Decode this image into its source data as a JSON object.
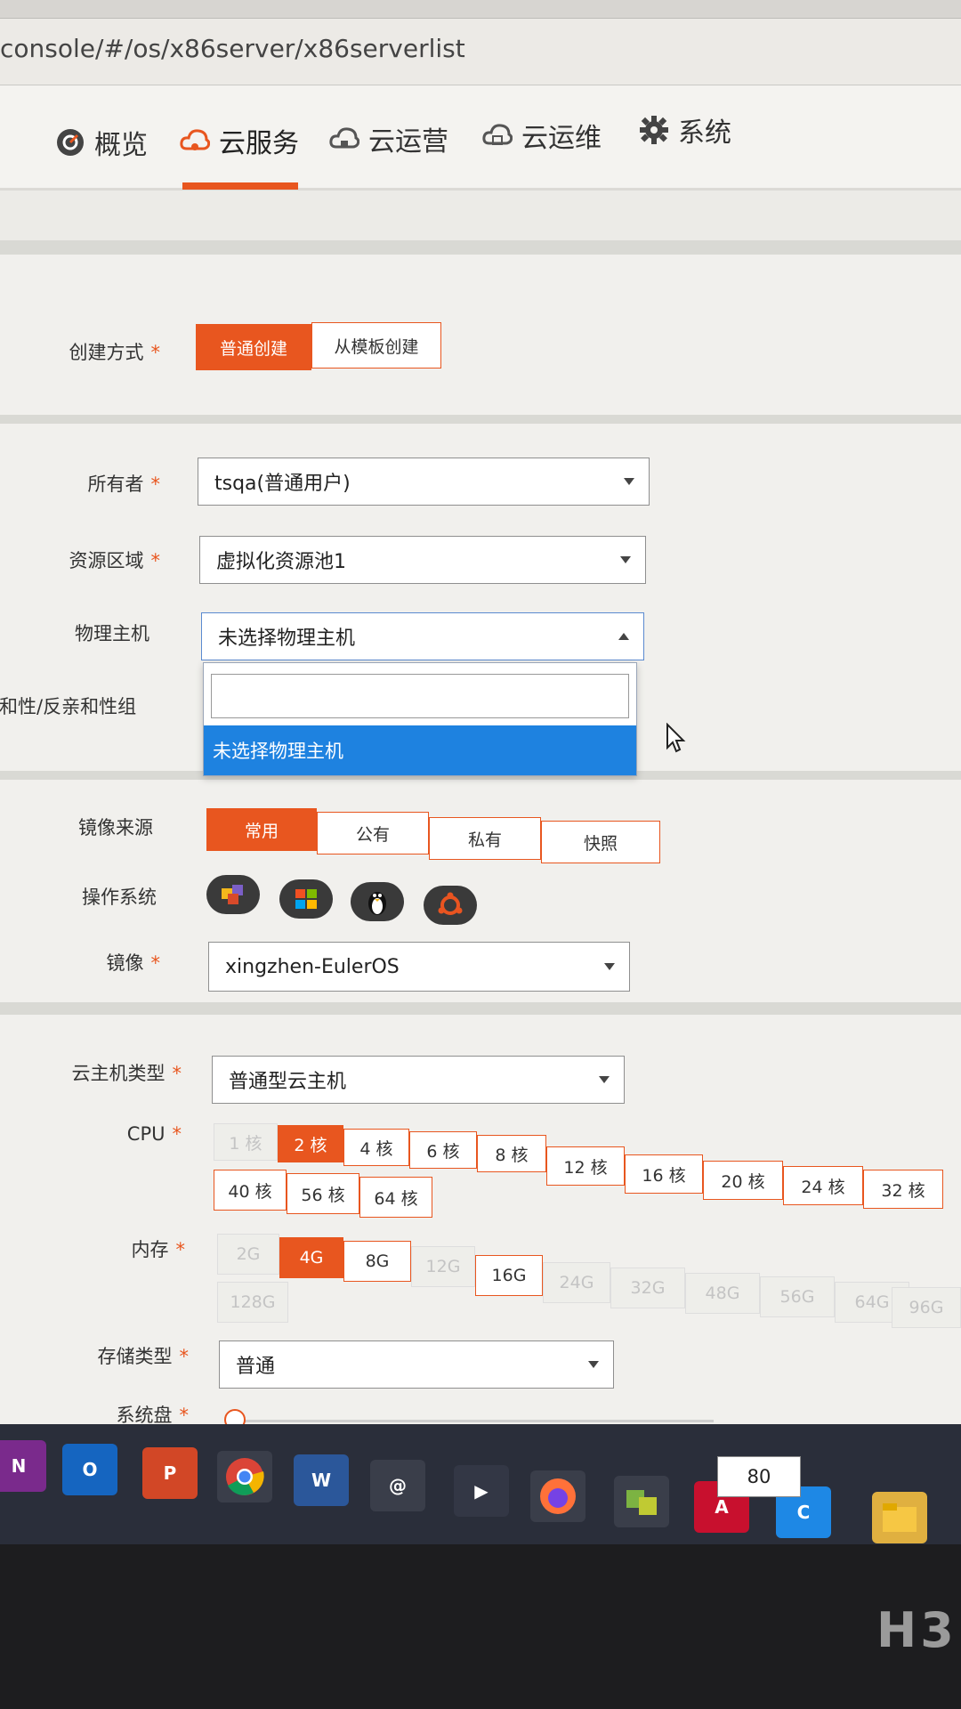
{
  "browser": {
    "url": "console/#/os/x86server/x86serverlist"
  },
  "nav": {
    "items": [
      {
        "label": "概览",
        "icon": "dashboard-icon"
      },
      {
        "label": "云服务",
        "icon": "cloud-service-icon"
      },
      {
        "label": "云运营",
        "icon": "cloud-operation-icon"
      },
      {
        "label": "云运维",
        "icon": "cloud-maintenance-icon"
      },
      {
        "label": "系统",
        "icon": "gear-icon"
      }
    ],
    "active": "云服务"
  },
  "form": {
    "create_mode": {
      "label": "创建方式",
      "options": [
        "普通创建",
        "从模板创建"
      ],
      "selected": "普通创建"
    },
    "owner": {
      "label": "所有者",
      "value": "tsqa(普通用户)"
    },
    "region": {
      "label": "资源区域",
      "value": "虚拟化资源池1"
    },
    "host": {
      "label": "物理主机",
      "value": "未选择物理主机",
      "dropdown_option": "未选择物理主机",
      "search_value": ""
    },
    "affinity": {
      "label": "亲和性/反亲和性组"
    },
    "image_source": {
      "label": "镜像来源",
      "options": [
        "常用",
        "公有",
        "私有",
        "快照"
      ],
      "selected": "常用"
    },
    "os": {
      "label": "操作系统",
      "icons": [
        "euleros-icon",
        "windows-icon",
        "linux-tux-icon",
        "ubuntu-icon"
      ]
    },
    "image": {
      "label": "镜像",
      "value": "xingzhen-EulerOS"
    },
    "vm_type": {
      "label": "云主机类型",
      "value": "普通型云主机"
    },
    "cpu": {
      "label": "CPU",
      "options": [
        "1 核",
        "2 核",
        "4 核",
        "6 核",
        "8 核",
        "12 核",
        "16 核",
        "20 核",
        "24 核",
        "32 核",
        "40 核",
        "56 核",
        "64 核"
      ],
      "selected": "2 核",
      "disabled": [
        "1 核"
      ]
    },
    "memory": {
      "label": "内存",
      "options": [
        "2G",
        "4G",
        "8G",
        "12G",
        "16G",
        "24G",
        "32G",
        "48G",
        "56G",
        "64G",
        "96G",
        "128G"
      ],
      "selected": "4G",
      "disabled": [
        "2G",
        "12G",
        "24G",
        "32G",
        "48G",
        "56G",
        "64G",
        "96G",
        "128G"
      ]
    },
    "storage_type": {
      "label": "存储类型",
      "value": "普通"
    },
    "system_disk": {
      "label": "系统盘",
      "value": "80"
    }
  },
  "taskbar": {
    "apps": [
      {
        "name": "onenote-icon",
        "glyph": "N",
        "color": "#7a2a8c"
      },
      {
        "name": "outlook-icon",
        "glyph": "O",
        "color": "#1565c0"
      },
      {
        "name": "powerpoint-icon",
        "glyph": "P",
        "color": "#d24726"
      },
      {
        "name": "chrome-icon",
        "glyph": "",
        "color": "#3a3e4a"
      },
      {
        "name": "word-icon",
        "glyph": "W",
        "color": "#2b579a"
      },
      {
        "name": "snail-icon",
        "glyph": "@",
        "color": "#3a3e4a"
      },
      {
        "name": "media-player-icon",
        "glyph": "▶",
        "color": "#333745"
      },
      {
        "name": "firefox-icon",
        "glyph": "",
        "color": "#3a3e4a"
      },
      {
        "name": "vmware-icon",
        "glyph": "",
        "color": "#3a3e4a"
      },
      {
        "name": "pdf-reader-icon",
        "glyph": "A",
        "color": "#c8102e"
      },
      {
        "name": "remote-connect-icon",
        "glyph": "C",
        "color": "#1e88e5"
      },
      {
        "name": "file-explorer-icon",
        "glyph": "",
        "color": "#e0b040"
      }
    ]
  },
  "monitor": {
    "brand": "H3"
  }
}
